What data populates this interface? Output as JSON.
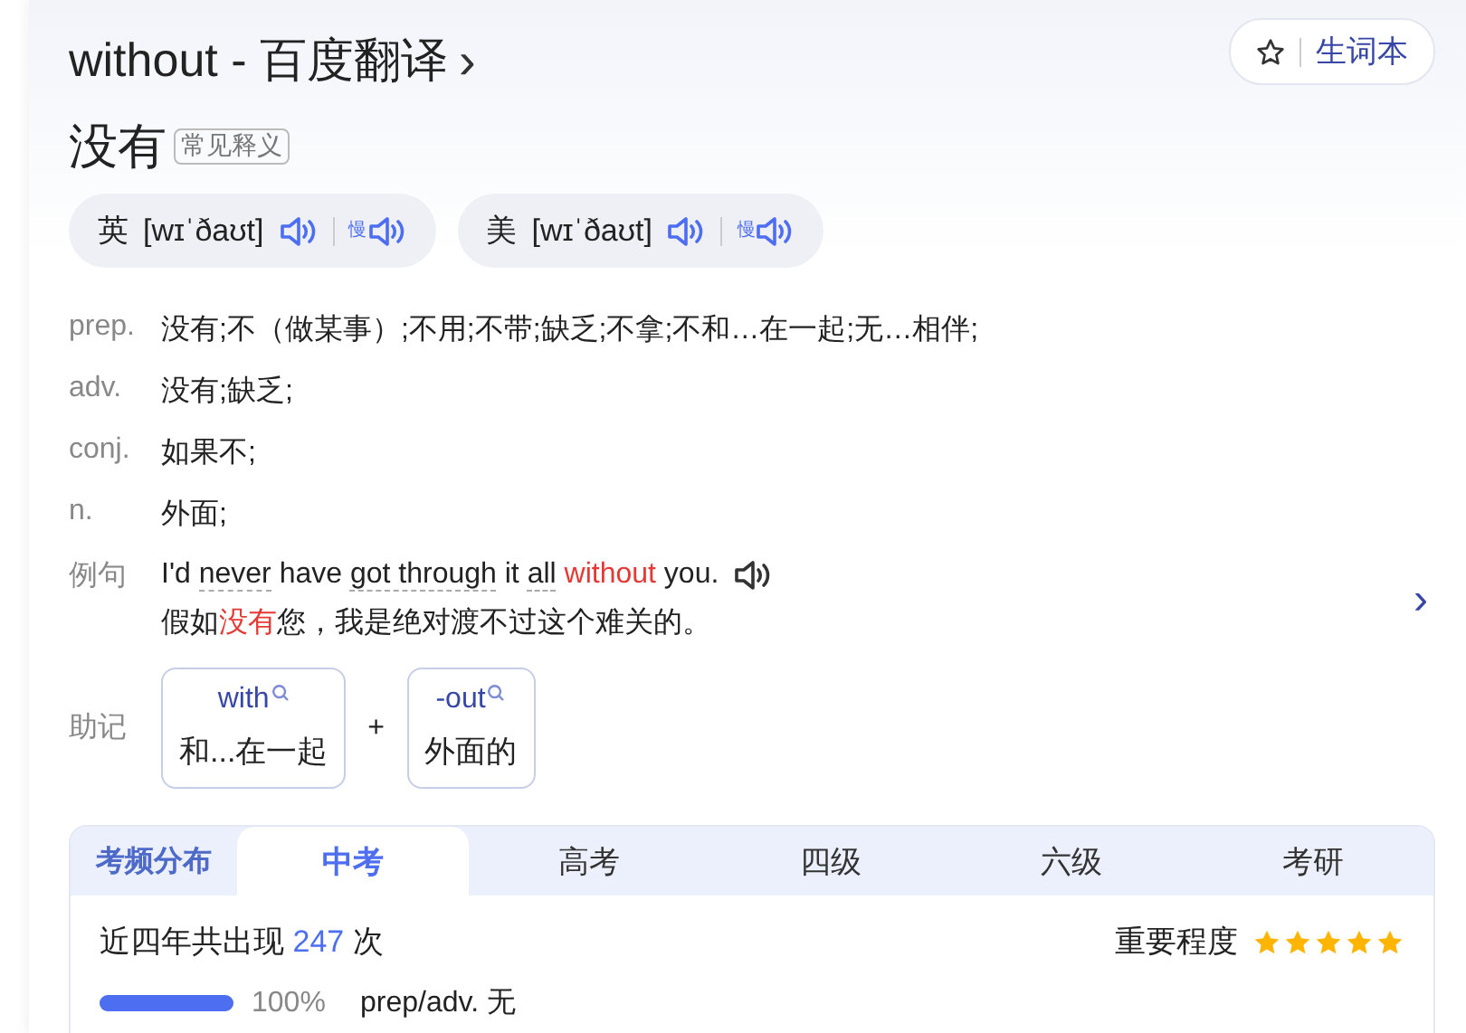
{
  "header": {
    "title": "without - 百度翻译",
    "chevron": "›",
    "wordbook": {
      "label": "生词本"
    }
  },
  "headword": {
    "text": "没有",
    "tag": "常见释义"
  },
  "pronunciations": [
    {
      "region": "英",
      "phonetic": "[wɪˈðaʊt]",
      "slow": "慢"
    },
    {
      "region": "美",
      "phonetic": "[wɪˈðaʊt]",
      "slow": "慢"
    }
  ],
  "definitions": [
    {
      "pos": "prep.",
      "meaning": "没有;不（做某事）;不用;不带;缺乏;不拿;不和…在一起;无…相伴;"
    },
    {
      "pos": "adv.",
      "meaning": "没有;缺乏;"
    },
    {
      "pos": "conj.",
      "meaning": "如果不;"
    },
    {
      "pos": "n.",
      "meaning": "外面;"
    }
  ],
  "example": {
    "label": "例句",
    "next": "›",
    "english": [
      {
        "kind": "plain",
        "text": "I'd "
      },
      {
        "kind": "link",
        "text": "never"
      },
      {
        "kind": "plain",
        "text": " have "
      },
      {
        "kind": "link",
        "text": "got through"
      },
      {
        "kind": "plain",
        "text": " it "
      },
      {
        "kind": "link",
        "text": "all"
      },
      {
        "kind": "highlight",
        "text": " without"
      },
      {
        "kind": "plain",
        "text": " you."
      }
    ],
    "chinese": [
      {
        "kind": "plain",
        "text": "假如"
      },
      {
        "kind": "highlight",
        "text": "没有"
      },
      {
        "kind": "plain",
        "text": "您，我是绝对渡不过这个难关的。"
      }
    ]
  },
  "mnemonic": {
    "label": "助记",
    "joiner": "+",
    "parts": [
      {
        "word": "with",
        "meaning": "和...在一起"
      },
      {
        "word": "-out",
        "meaning": "外面的"
      }
    ]
  },
  "exam": {
    "label": "考频分布",
    "tabs": [
      {
        "label": "中考",
        "selected": true
      },
      {
        "label": "高考",
        "selected": false
      },
      {
        "label": "四级",
        "selected": false
      },
      {
        "label": "六级",
        "selected": false
      },
      {
        "label": "考研",
        "selected": false
      }
    ],
    "count_prefix": "近四年共出现",
    "count": "247",
    "count_suffix": "次",
    "importance_label": "重要程度",
    "stars": 5,
    "usage": [
      {
        "level": 1,
        "percent": "100%",
        "text": "prep/adv. 无"
      }
    ]
  }
}
